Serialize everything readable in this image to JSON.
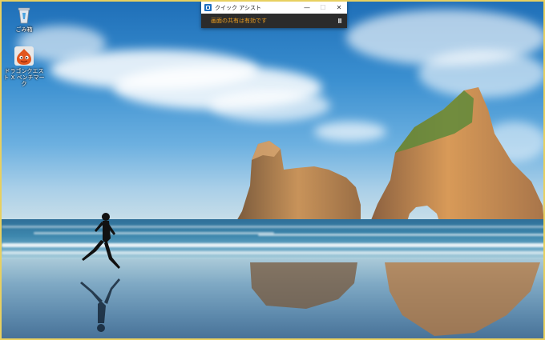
{
  "desktop": {
    "icons": [
      {
        "label": "ごみ箱",
        "icon": "recycle-bin-icon"
      },
      {
        "label": "ドラゴンクエスト X ベンチマーク",
        "icon": "dragon-quest-slime-icon"
      }
    ],
    "wallpaper": "beach-with-rock-arches-and-runner"
  },
  "quick_assist": {
    "title": "クイック アシスト",
    "status": "画面の共有は有効です",
    "status_color": "#f0a020",
    "minimize_label": "—",
    "maximize_label": "☐",
    "close_label": "✕",
    "pause_label": "Ⅱ"
  }
}
